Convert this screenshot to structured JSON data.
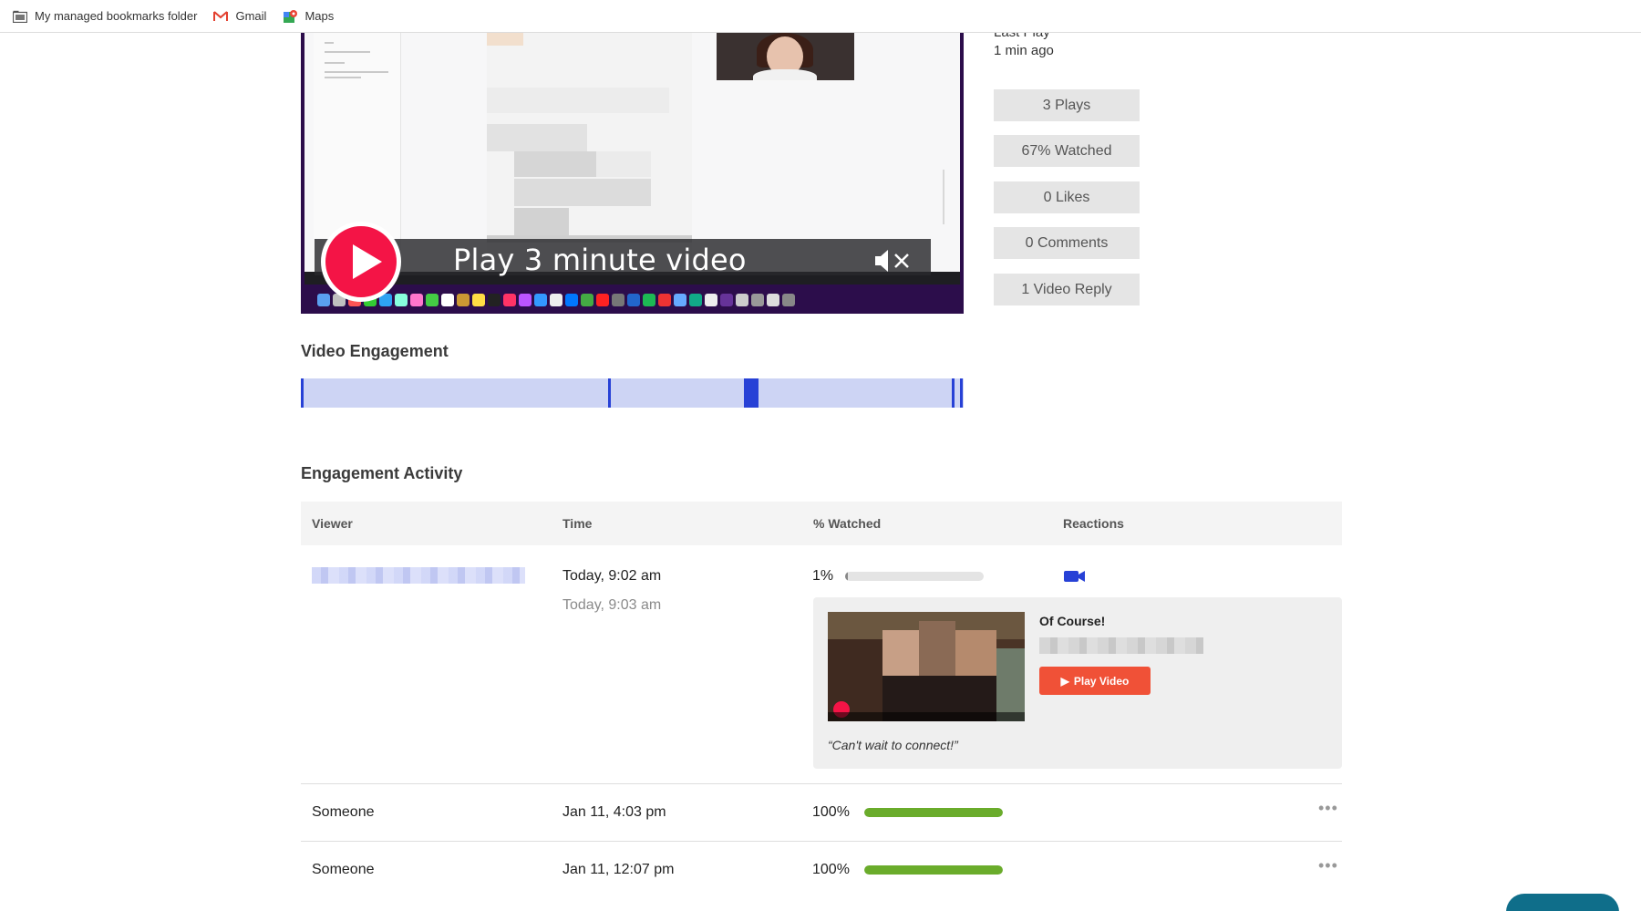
{
  "bookmarks": [
    {
      "label": "My managed bookmarks folder",
      "icon": "folder-icon"
    },
    {
      "label": "Gmail",
      "icon": "gmail-icon"
    },
    {
      "label": "Maps",
      "icon": "maps-icon"
    }
  ],
  "video": {
    "overlay_title": "Play 3 minute video",
    "play_icon": "play-icon",
    "mute_icon": "mute-icon"
  },
  "stats": {
    "last_play_label": "Last Play",
    "last_play_value": "1 min ago",
    "pills": [
      "3 Plays",
      "67% Watched",
      "0 Likes",
      "0 Comments",
      "1 Video Reply"
    ]
  },
  "video_engagement": {
    "title": "Video Engagement"
  },
  "engagement_activity": {
    "title": "Engagement Activity",
    "headers": [
      "Viewer",
      "Time",
      "% Watched",
      "Reactions"
    ],
    "rows": [
      {
        "viewer": "",
        "time": "Today, 9:02 am",
        "time_sub": "Today, 9:03 am",
        "pct": "1%",
        "pct_value": 0.01,
        "reaction_icon": "video-camera-icon",
        "reply": {
          "title": "Of Course!",
          "button": "Play Video",
          "quote": "“Can't wait to connect!”"
        }
      },
      {
        "viewer": "Someone",
        "time": "Jan 11, 4:03 pm",
        "pct": "100%",
        "pct_value": 1.0
      },
      {
        "viewer": "Someone",
        "time": "Jan 11, 12:07 pm",
        "pct": "100%",
        "pct_value": 1.0
      }
    ]
  },
  "colors": {
    "play_red": "#f41446",
    "engagement_blue": "#2741d6",
    "progress_green": "#6aac2b",
    "reply_button": "#f05137"
  }
}
